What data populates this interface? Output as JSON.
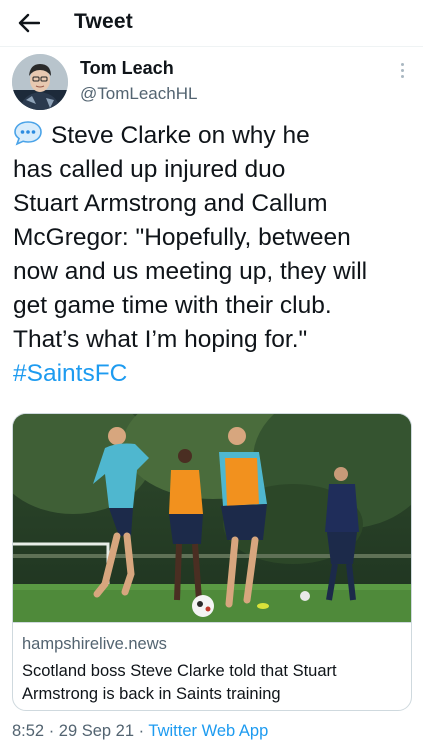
{
  "header": {
    "title": "Tweet",
    "back_icon": "arrow-left-icon"
  },
  "author": {
    "name": "Tom Leach",
    "handle": "@TomLeachHL",
    "avatar_icon": "avatar"
  },
  "tweet": {
    "lines": [
      "Steve Clarke on why he",
      "has called up injured duo",
      "Stuart Armstrong and Callum",
      "McGregor: \"Hopefully, between",
      "now and us meeting up, they will",
      "get game time with their club.",
      "That’s what I’m hoping for.\""
    ],
    "hashtag": "#SaintsFC",
    "leading_icon": "speech-balloon-icon"
  },
  "card": {
    "domain": "hampshirelive.news",
    "title": "Scotland boss Steve Clarke told that Stuart Armstrong is back in Saints training"
  },
  "meta": {
    "time": "8:52",
    "separator": " · ",
    "date": "29 Sep 21",
    "separator2": " · ",
    "source": "Twitter Web App"
  },
  "colors": {
    "accent": "#1d9bf0",
    "secondary_text": "#536471",
    "border": "#cfd9de"
  }
}
